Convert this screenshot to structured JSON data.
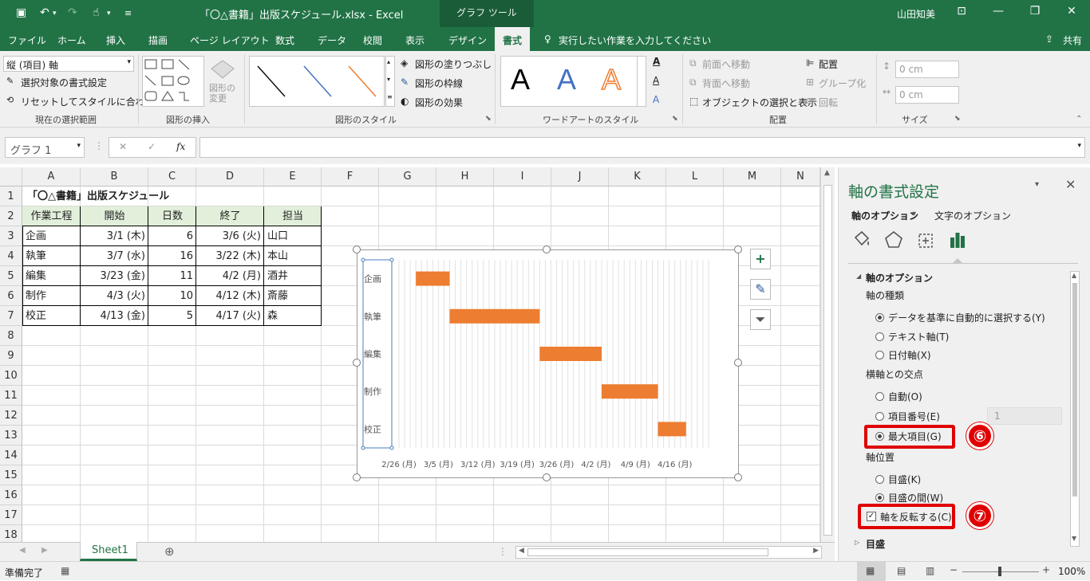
{
  "titlebar": {
    "file_title": "「〇△書籍」出版スケジュール.xlsx  -  Excel",
    "context_tab": "グラフ ツール",
    "user": "山田知美"
  },
  "tabs": [
    "ファイル",
    "ホーム",
    "挿入",
    "描画",
    "ページ レイアウト",
    "数式",
    "データ",
    "校閲",
    "表示",
    "デザイン",
    "書式"
  ],
  "active_tab": "書式",
  "tellme": "実行したい作業を入力してください",
  "share": "共有",
  "ribbon": {
    "selection_dropdown": "縦 (項目) 軸",
    "format_selection": "選択対象の書式設定",
    "reset_style": "リセットしてスタイルに合わせる",
    "grp_current": "現在の選択範囲",
    "change_shape": "図形の\n変更",
    "grp_insert": "図形の挿入",
    "fill": "図形の塗りつぶし",
    "outline": "図形の枠線",
    "effects": "図形の効果",
    "grp_styles": "図形のスタイル",
    "grp_wordart": "ワードアートのスタイル",
    "bring_forward": "前面へ移動",
    "send_backward": "背面へ移動",
    "selection_pane": "オブジェクトの選択と表示",
    "align": "配置",
    "group": "グループ化",
    "rotate": "回転",
    "grp_arrange": "配置",
    "height": "0 cm",
    "width": "0 cm",
    "grp_size": "サイズ"
  },
  "namebox": "グラフ 1",
  "formula": "",
  "columns": [
    "A",
    "B",
    "C",
    "D",
    "E",
    "F",
    "G",
    "H",
    "I",
    "J",
    "K",
    "L",
    "M",
    "N"
  ],
  "rows": [
    "1",
    "2",
    "3",
    "4",
    "5",
    "6",
    "7",
    "8",
    "9",
    "10",
    "11",
    "12",
    "13",
    "14",
    "15",
    "16",
    "17",
    "18"
  ],
  "sheet": {
    "title": "「〇△書籍」出版スケジュール",
    "headers": [
      "作業工程",
      "開始",
      "日数",
      "終了",
      "担当"
    ],
    "data": [
      [
        "企画",
        "3/1 (木)",
        "6",
        "3/6 (火)",
        "山口"
      ],
      [
        "執筆",
        "3/7 (水)",
        "16",
        "3/22 (木)",
        "本山"
      ],
      [
        "編集",
        "3/23 (金)",
        "11",
        "4/2 (月)",
        "酒井"
      ],
      [
        "制作",
        "4/3 (火)",
        "10",
        "4/12 (木)",
        "斎藤"
      ],
      [
        "校正",
        "4/13 (金)",
        "5",
        "4/17 (火)",
        "森"
      ]
    ]
  },
  "chart_data": {
    "type": "bar",
    "stacked": true,
    "categories": [
      "企画",
      "執筆",
      "編集",
      "制作",
      "校正"
    ],
    "start": [
      "3/1",
      "3/7",
      "3/23",
      "4/3",
      "4/13"
    ],
    "duration_days": [
      6,
      16,
      11,
      10,
      5
    ],
    "x_ticks": [
      "2/26 (月)",
      "3/5 (月)",
      "3/12 (月)",
      "3/19 (月)",
      "3/26 (月)",
      "4/2 (月)",
      "4/9 (月)",
      "4/16 (月)"
    ],
    "xlim": [
      "2/26",
      "4/22"
    ],
    "bar_color": "#ed7d31",
    "reverse_category_order": true,
    "grid": "vertical"
  },
  "sheet_tab": "Sheet1",
  "status": {
    "ready": "準備完了",
    "zoom": "100%"
  },
  "pane": {
    "title": "軸の書式設定",
    "tab_axis_options": "軸のオプション",
    "tab_text_options": "文字のオプション",
    "section": "軸のオプション",
    "axis_type_label": "軸の種類",
    "opt_auto": "データを基準に自動的に選択する(Y)",
    "opt_text": "テキスト軸(T)",
    "opt_date": "日付軸(X)",
    "crosses_label": "横軸との交点",
    "cross_auto": "自動(O)",
    "cross_index": "項目番号(E)",
    "cross_index_value": "1",
    "cross_max": "最大項目(G)",
    "position_label": "軸位置",
    "pos_on": "目盛(K)",
    "pos_between": "目盛の間(W)",
    "reverse": "軸を反転する(C)",
    "ticks": "目盛"
  },
  "markers": [
    "⑥",
    "⑦"
  ]
}
